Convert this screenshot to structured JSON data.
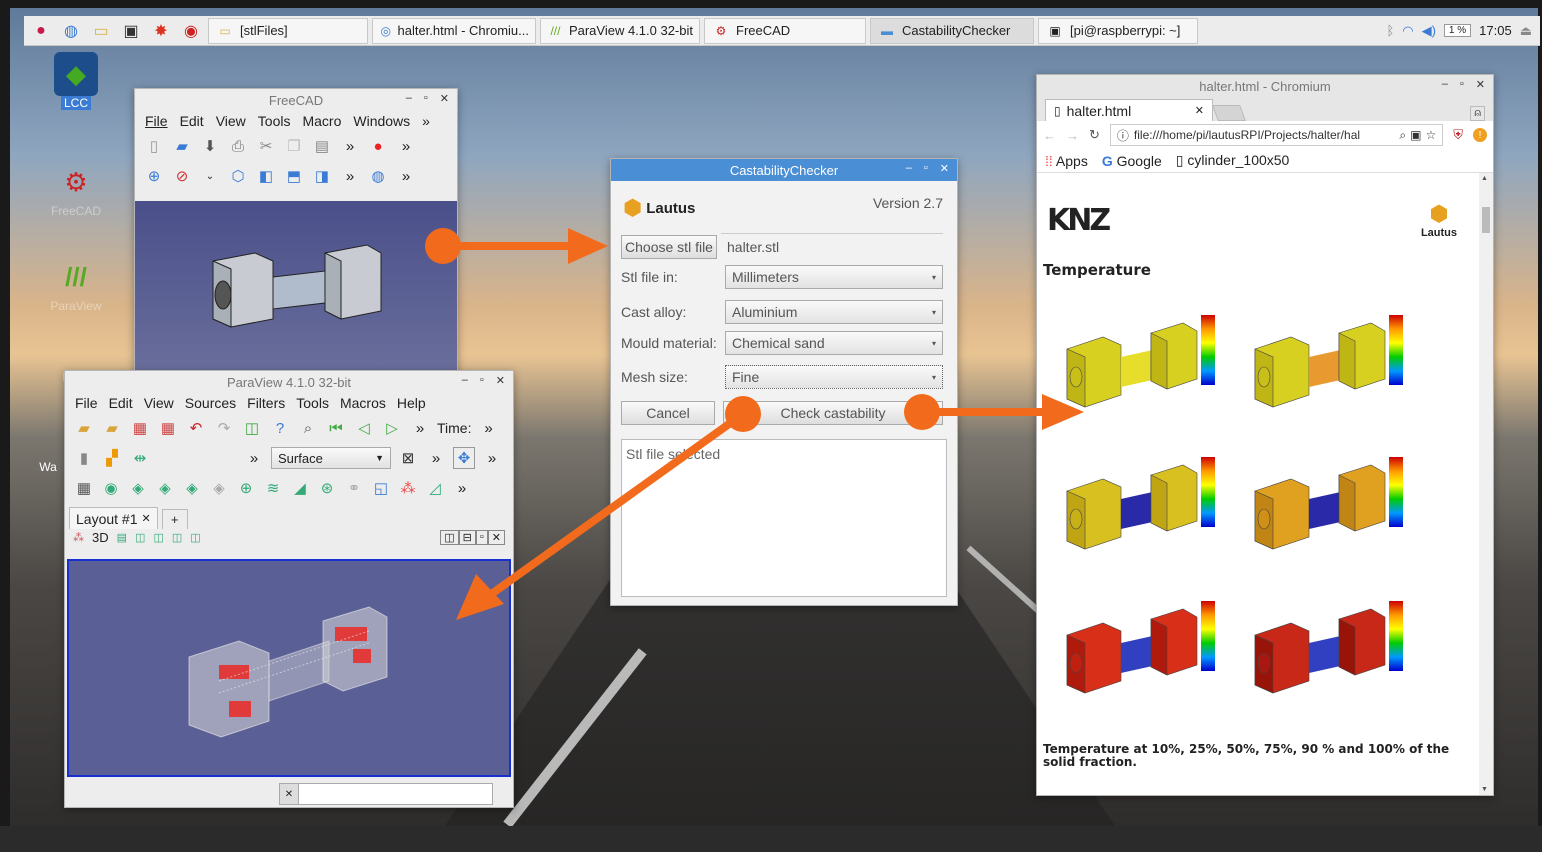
{
  "taskbar": {
    "tasks": [
      {
        "label": "[stlFiles]",
        "icon": "folder-icon"
      },
      {
        "label": "halter.html - Chromiu...",
        "icon": "chromium-icon"
      },
      {
        "label": "ParaView 4.1.0 32-bit",
        "icon": "paraview-icon"
      },
      {
        "label": "FreeCAD",
        "icon": "freecad-icon"
      },
      {
        "label": "CastabilityChecker",
        "icon": "window-icon"
      },
      {
        "label": "[pi@raspberrypi: ~]",
        "icon": "terminal-icon"
      }
    ],
    "cpu": "1 %",
    "clock": "17:05"
  },
  "desktop": {
    "icons": [
      {
        "label": "LCC"
      },
      {
        "label": "FreeCAD"
      },
      {
        "label": "ParaView"
      },
      {
        "label": "Wa"
      }
    ]
  },
  "freecad": {
    "title": "FreeCAD",
    "menu": [
      "File",
      "Edit",
      "View",
      "Tools",
      "Macro",
      "Windows"
    ]
  },
  "paraview": {
    "title": "ParaView 4.1.0 32-bit",
    "menu": [
      "File",
      "Edit",
      "View",
      "Sources",
      "Filters",
      "Tools",
      "Macros",
      "Help"
    ],
    "time_label": "Time:",
    "representation": "Surface",
    "layout_tab": "Layout #1",
    "view_mode": "3D"
  },
  "castability": {
    "title": "CastabilityChecker",
    "brand": "Lautus",
    "version": "Version 2.7",
    "choose_button": "Choose stl file",
    "file_name": "halter.stl",
    "stl_label": "Stl file in:",
    "stl_value": "Millimeters",
    "alloy_label": "Cast alloy:",
    "alloy_value": "Aluminium",
    "mould_label": "Mould material:",
    "mould_value": "Chemical sand",
    "mesh_label": "Mesh size:",
    "mesh_value": "Fine",
    "cancel_button": "Cancel",
    "check_button": "Check castability",
    "log_text": "Stl file selected"
  },
  "chromium": {
    "title": "halter.html - Chromium",
    "tab_label": "halter.html",
    "url": "file:///home/pi/lautusRPI/Projects/halter/hal",
    "bookmarks": [
      "Apps",
      "Google",
      "cylinder_100x50"
    ],
    "page": {
      "logo_left": "KNZ",
      "logo_right": "Lautus",
      "heading": "Temperature",
      "caption": "Temperature at 10%, 25%, 50%, 75%, 90 % and 100% of the solid fraction."
    }
  },
  "colors": {
    "accent_arrow": "#f26b1d",
    "dialog_title": "#4a8ed6",
    "viewport": "#5a5f95"
  }
}
